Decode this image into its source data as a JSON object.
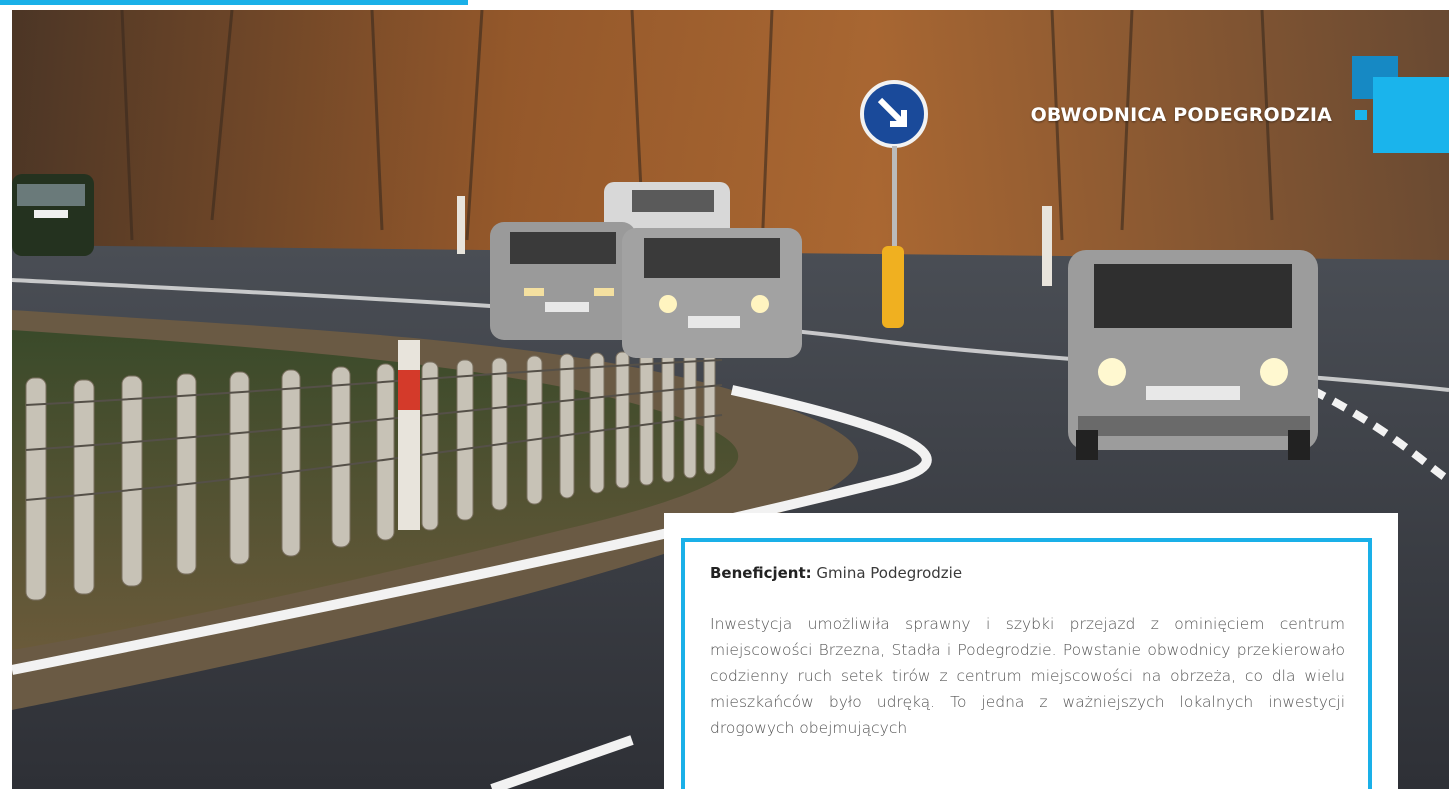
{
  "header": {
    "title": "OBWODNICA PODEGRODZIA"
  },
  "photo": {
    "subject": "road-bypass-photo"
  },
  "info": {
    "beneficiary_label": "Beneficjent:",
    "beneficiary_value": "Gmina Podegrodzie",
    "description": "Inwestycja umożliwiła sprawny i szybki przejazd z ominięciem centrum miejscowości Brzezna, Stadła i Podegrodzie. Powstanie obwodnicy przekierowało codzienny ruch setek tirów z centrum miejscowości na obrzeża, co dla wielu mieszkańców było udręką. To jedna z ważniejszych lokalnych inwestycji drogowych obejmujących"
  },
  "colors": {
    "accent": "#1ab0e8",
    "accent_dark": "#1689c4"
  }
}
